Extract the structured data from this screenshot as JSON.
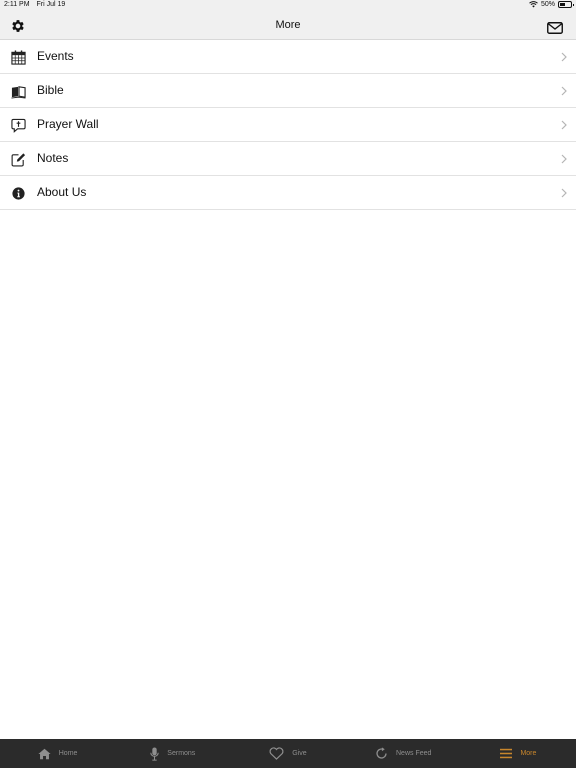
{
  "status_bar": {
    "time": "2:11 PM",
    "date": "Fri Jul 19",
    "battery": "50%",
    "battery_level": 0.5
  },
  "nav_bar": {
    "title": "More",
    "left_icon": "gear-icon",
    "right_icon": "envelope-icon"
  },
  "menu": {
    "items": [
      {
        "label": "Events",
        "icon": "calendar-icon"
      },
      {
        "label": "Bible",
        "icon": "open-book-icon"
      },
      {
        "label": "Prayer Wall",
        "icon": "speech-bubble-icon"
      },
      {
        "label": "Notes",
        "icon": "edit-note-icon"
      },
      {
        "label": "About Us",
        "icon": "info-icon"
      }
    ]
  },
  "tab_bar": {
    "tabs": [
      {
        "label": "Home",
        "icon": "home-icon"
      },
      {
        "label": "Sermons",
        "icon": "microphone-icon"
      },
      {
        "label": "Give",
        "icon": "heart-icon"
      },
      {
        "label": "News Feed",
        "icon": "refresh-icon"
      },
      {
        "label": "More",
        "icon": "menu-icon"
      }
    ],
    "active": "More",
    "active_color": "#c8862c",
    "inactive_color": "#8e8e8e",
    "background": "#2b2b2b"
  }
}
